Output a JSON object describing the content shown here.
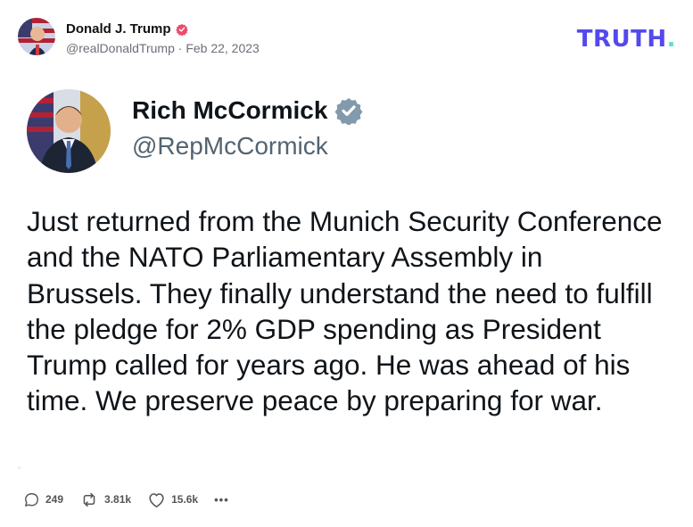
{
  "post": {
    "author_name": "Donald J. Trump",
    "author_handle": "@realDonaldTrump",
    "separator": "·",
    "date": "Feb 22, 2023",
    "brand": "TRUTH",
    "brand_dot": "."
  },
  "quoted": {
    "name": "Rich McCormick",
    "handle": "@RepMcCormick",
    "text": "Just returned from the Munich Security Conference and the NATO Parliamentary Assembly in Brussels. They finally understand the need to fulfill the pledge for 2% GDP spending as President Trump called for years ago. He was ahead of his time. We preserve peace by preparing for war."
  },
  "actions": {
    "replies": "249",
    "retruths": "3.81k",
    "likes": "15.6k",
    "more": "•••"
  },
  "colors": {
    "brand": "#5448ee",
    "brand_dot": "#5ddfc4",
    "verified_pink": "#ea4c6f",
    "verified_grey": "#829aab"
  },
  "icons": [
    "verified-badge-icon",
    "reply-icon",
    "retruth-icon",
    "heart-icon",
    "more-icon"
  ]
}
